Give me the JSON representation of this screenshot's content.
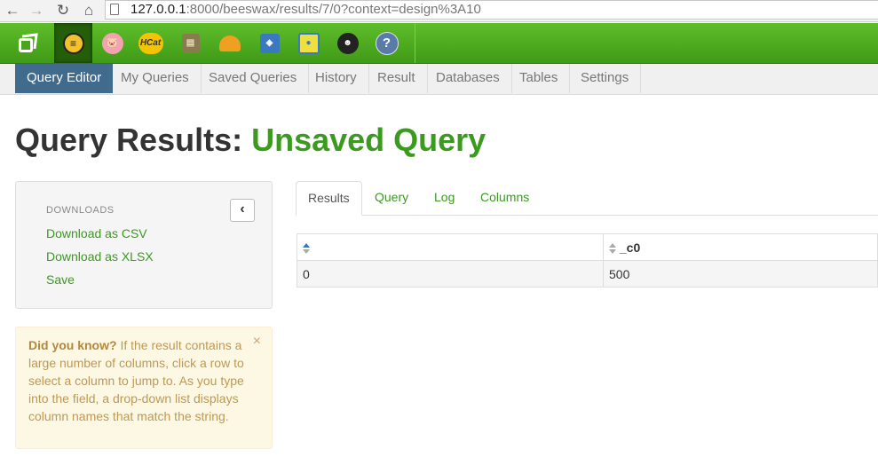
{
  "browser": {
    "url_host": "127.0.0.1",
    "url_rest": ":8000/beeswax/results/7/0?context=design%3A10"
  },
  "toolbar": {
    "apps": [
      {
        "name": "hue-home-icon",
        "label": ""
      },
      {
        "name": "beeswax-icon",
        "label": ""
      },
      {
        "name": "pig-icon",
        "label": ""
      },
      {
        "name": "hcatalog-icon",
        "label": "HCat"
      },
      {
        "name": "file-browser-icon",
        "label": ""
      },
      {
        "name": "job-designer-icon",
        "label": ""
      },
      {
        "name": "job-browser-icon",
        "label": ""
      },
      {
        "name": "oozie-icon",
        "label": ""
      },
      {
        "name": "user-admin-icon",
        "label": ""
      },
      {
        "name": "help-icon",
        "label": "?"
      }
    ]
  },
  "subnav": {
    "items": [
      "Query Editor",
      "My Queries",
      "Saved Queries",
      "History",
      "Result",
      "Databases",
      "Tables",
      "Settings"
    ]
  },
  "page": {
    "title_prefix": "Query Results:",
    "title_name": "Unsaved Query"
  },
  "sidebar": {
    "header": "DOWNLOADS",
    "links": [
      "Download as CSV",
      "Download as XLSX",
      "Save"
    ],
    "collapse_glyph": "‹"
  },
  "tip": {
    "bold": "Did you know?",
    "text": " If the result contains a large number of columns, click a row to select a column to jump to. As you type into the field, a drop-down list displays column names that match the string.",
    "close": "×"
  },
  "tabs": [
    "Results",
    "Query",
    "Log",
    "Columns"
  ],
  "results": {
    "columns": [
      "",
      "_c0"
    ],
    "rows": [
      [
        "0",
        "500"
      ]
    ]
  },
  "colors": {
    "accent_green": "#3b9a1f",
    "active_tab_blue": "#416b8c",
    "toolbar_green": "#4fad20"
  }
}
